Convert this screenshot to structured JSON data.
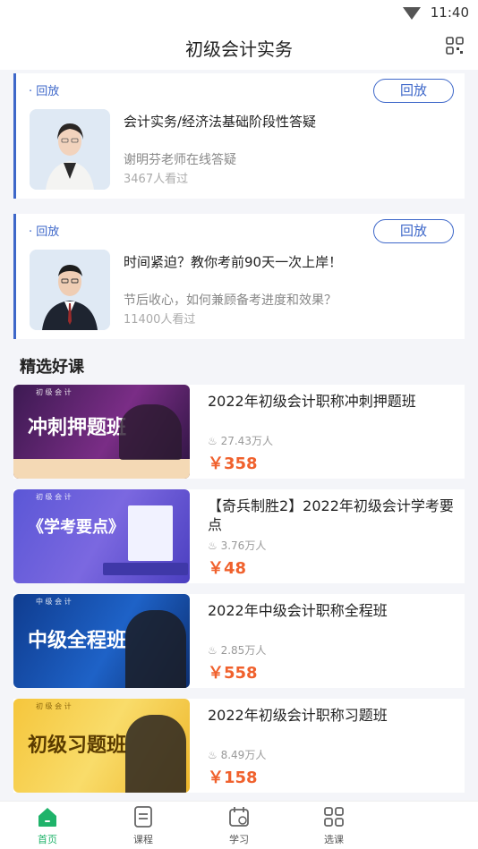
{
  "status": {
    "time": "11:40"
  },
  "header": {
    "title": "初级会计实务"
  },
  "live_sessions": [
    {
      "tag": "· 回放",
      "button": "回放",
      "title": "会计实务/经济法基础阶段性答疑",
      "subtitle": "谢明芬老师在线答疑",
      "views": "3467人看过"
    },
    {
      "tag": "· 回放",
      "button": "回放",
      "title": "时间紧迫？教你考前90天一次上岸！",
      "subtitle": "节后收心，如何兼顾备考进度和效果？",
      "views": "11400人看过"
    }
  ],
  "section": {
    "title": "精选好课"
  },
  "courses": [
    {
      "title": "2022年初级会计职称冲刺押题班",
      "learners": "27.43万人",
      "price": "￥358",
      "thumb_text": "冲刺押题班",
      "thumb_top": "初 级 会 计"
    },
    {
      "title": "【奇兵制胜2】2022年初级会计学考要点",
      "learners": "3.76万人",
      "price": "￥48",
      "thumb_text": "《学考要点》",
      "thumb_top": "初 级 会 计"
    },
    {
      "title": "2022年中级会计职称全程班",
      "learners": "2.85万人",
      "price": "￥558",
      "thumb_text": "中级全程班",
      "thumb_top": "中 级 会 计"
    },
    {
      "title": "2022年初级会计职称习题班",
      "learners": "8.49万人",
      "price": "￥158",
      "thumb_text": "初级习题班",
      "thumb_top": "初 级 会 计"
    }
  ],
  "tabbar": [
    {
      "label": "首页",
      "icon": "home-icon",
      "active": true
    },
    {
      "label": "课程",
      "icon": "course-icon",
      "active": false
    },
    {
      "label": "学习",
      "icon": "calendar-icon",
      "active": false
    },
    {
      "label": "选课",
      "icon": "grid-icon",
      "active": false
    }
  ],
  "colors": {
    "accent": "#3d67c9",
    "price": "#f0612d",
    "active_tab": "#1fb36a"
  }
}
